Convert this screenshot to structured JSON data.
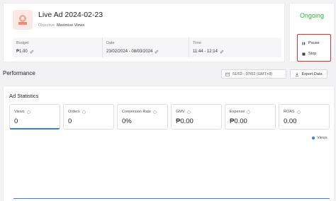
{
  "ad": {
    "title": "Live Ad 2024-02-23",
    "objective_label": "Objective",
    "objective_value": "Maximise Views",
    "thumb_icon": "ad-thumbnail-icon",
    "budget_label": "Budget",
    "budget_value": "₱1.00",
    "date_label": "Date",
    "date_value": "23/02/2024 - 08/03/2024",
    "time_label": "Time",
    "time_value": "11:44 - 12:14"
  },
  "status": {
    "text": "Ongoing",
    "color": "#2db33a",
    "pause_label": "Pause",
    "stop_label": "Stop",
    "highlight_color": "#e03131"
  },
  "performance": {
    "title": "Performance",
    "date_range": "01/02 - 07/02 (GMT+8)",
    "export_label": "Export Data"
  },
  "stats": {
    "title": "Ad Statistics",
    "metrics": [
      {
        "label": "Views",
        "value": "0"
      },
      {
        "label": "Orders",
        "value": "0"
      },
      {
        "label": "Conversion Rate",
        "value": "0%"
      },
      {
        "label": "GMV",
        "value": "₱0.00"
      },
      {
        "label": "Expense",
        "value": "₱0.00"
      },
      {
        "label": "ROAS",
        "value": "0.00"
      }
    ],
    "legend": "Views",
    "accent_color": "#3b7ddd"
  }
}
